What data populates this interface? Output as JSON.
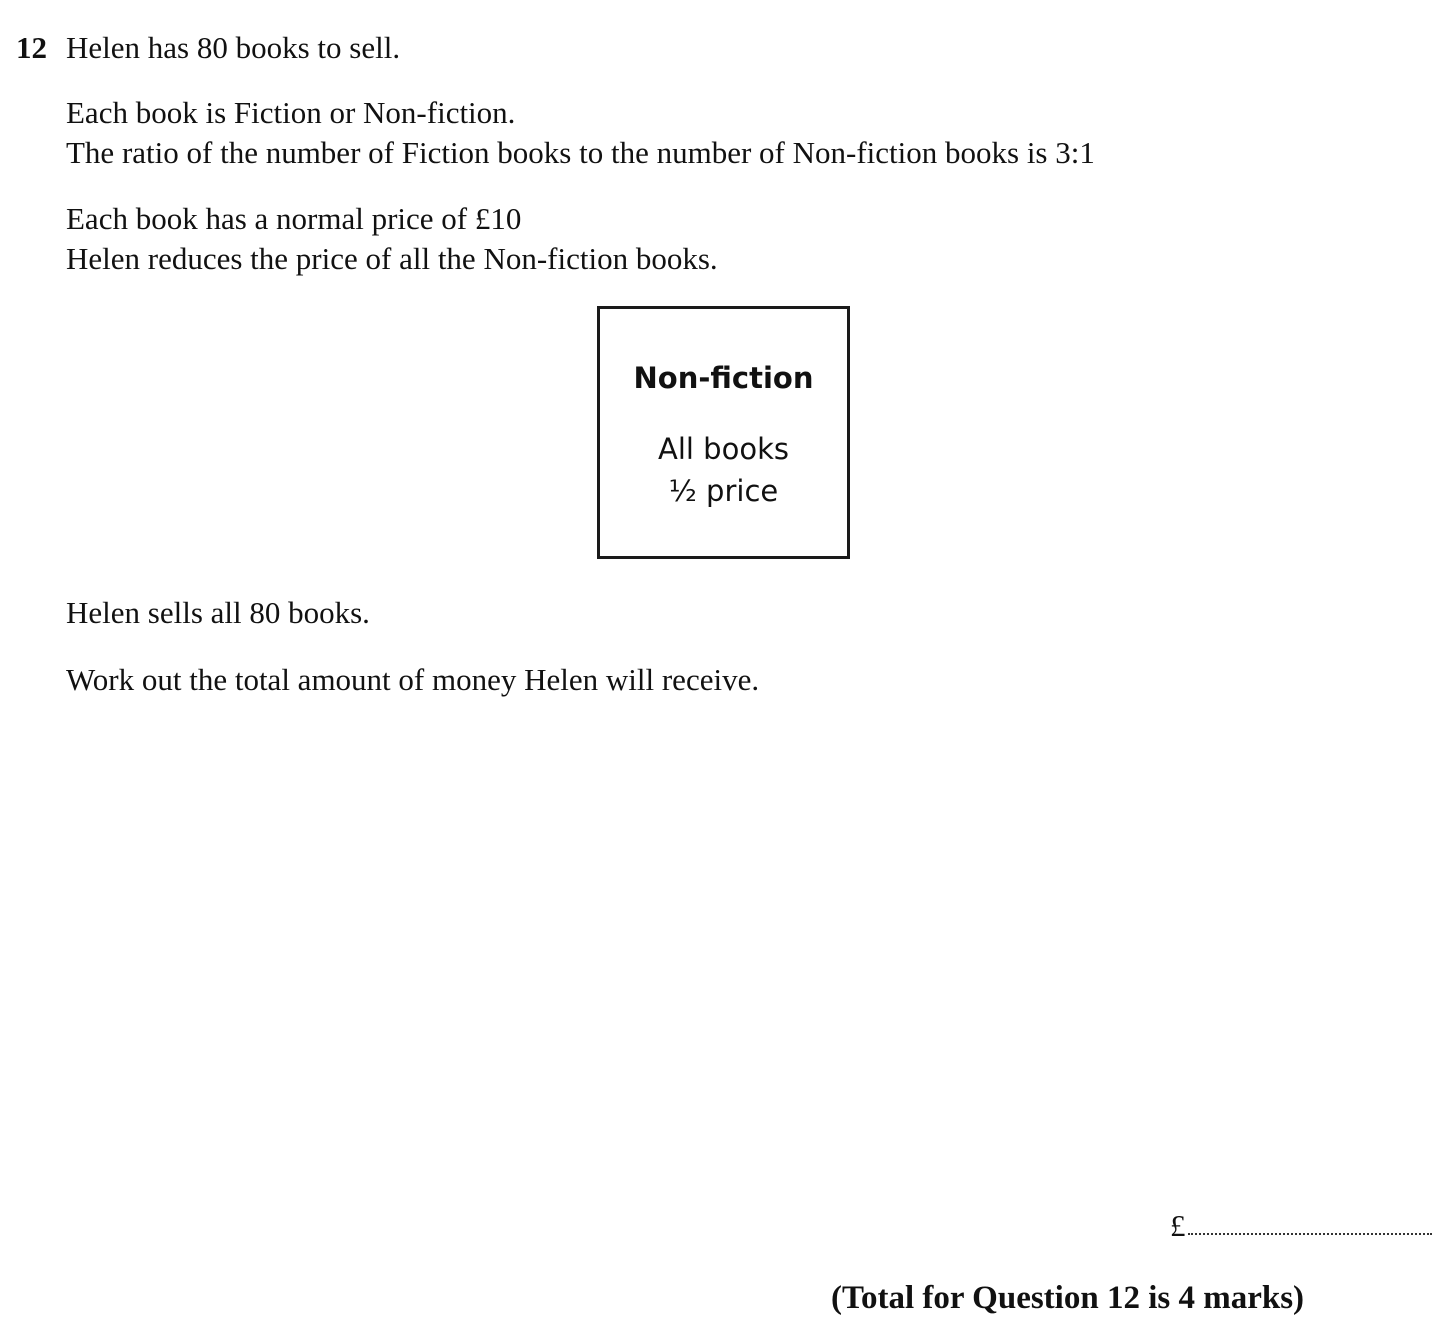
{
  "question": {
    "number": "12",
    "lines": [
      "Helen has 80 books to sell.",
      "Each book is Fiction or Non-fiction.",
      "The ratio of the number of Fiction books to the number of Non-fiction books is 3:1",
      "Each book has a normal price of £10",
      "Helen reduces the price of all the Non-fiction books.",
      "Helen sells all 80 books.",
      "Work out the total amount of money Helen will receive."
    ]
  },
  "notice": {
    "title": "Non-fiction",
    "line1": "All books",
    "line2": "½ price"
  },
  "answer": {
    "currency": "£"
  },
  "total_marks": "(Total for Question 12 is 4 marks)"
}
